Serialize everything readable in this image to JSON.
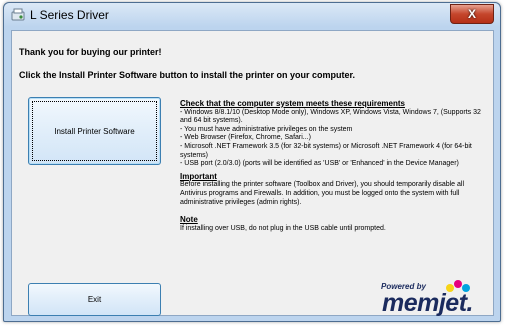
{
  "window": {
    "title": "L Series Driver",
    "close_label": "X"
  },
  "main": {
    "thanks_text": "Thank you for buying our printer!",
    "instruction_text": "Click the Install Printer Software button to install the printer on your computer."
  },
  "buttons": {
    "install_label": "Install Printer Software",
    "exit_label": "Exit"
  },
  "requirements": {
    "heading": "Check that the computer system meets these requirements",
    "items": [
      "- Windows 8/8.1/10 (Desktop Mode only), Windows XP, Windows Vista, Windows 7, (Supports 32 and 64 bit systems).",
      "- You must have administrative privileges on the system",
      "- Web Browser (Firefox, Chrome, Safari...)",
      "- Microsoft .NET Framework 3.5 (for 32-bit systems) or Microsoft .NET Framework 4 (for 64-bit systems)",
      "- USB port (2.0/3.0) (ports will be identified as 'USB' or 'Enhanced' in the Device Manager)"
    ]
  },
  "important": {
    "heading": "Important",
    "text": "Before installing the printer software (Toolbox and Driver), you should temporarily disable all Antivirus programs and Firewalls. In addition, you must be logged onto the system with full administrative privileges (admin rights)."
  },
  "note": {
    "heading": "Note",
    "text": "If installing over USB, do not plug in the USB cable until prompted."
  },
  "logo": {
    "powered_by": "Powered by",
    "brand": "memjet."
  },
  "colors": {
    "titlebar": "#bcd4ee",
    "close_button": "#c5462c",
    "button_border": "#3c7fb1",
    "brand": "#1b2b5e",
    "dot_yellow": "#f7d417",
    "dot_magenta": "#e6007e",
    "dot_cyan": "#00a3e0"
  }
}
